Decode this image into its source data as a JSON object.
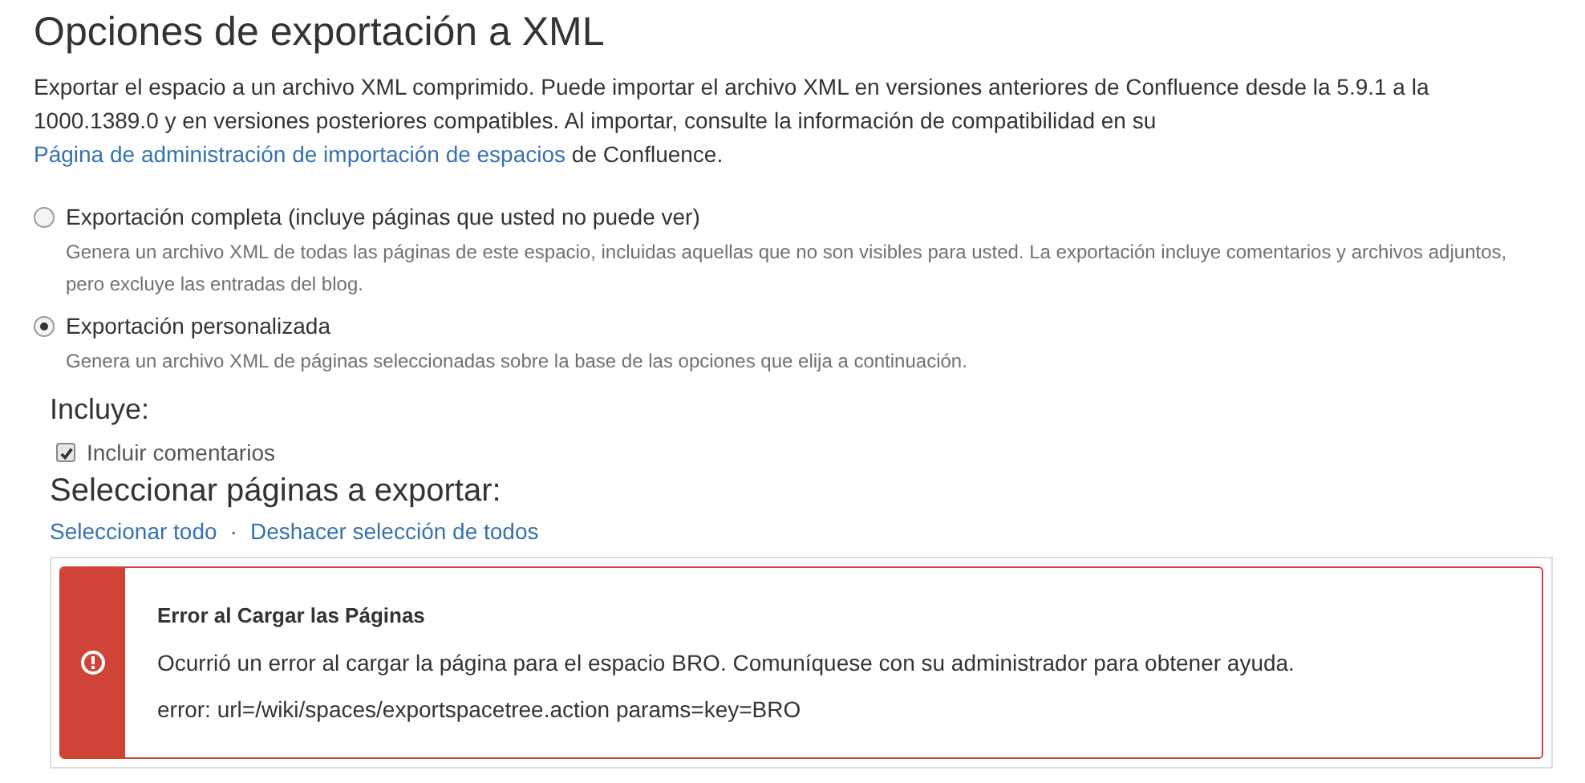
{
  "title": "Opciones de exportación a XML",
  "intro": {
    "before": "Exportar el espacio a un archivo XML comprimido. Puede importar el archivo XML en versiones anteriores de Confluence desde la 5.9.1 a la 1000.1389.0 y en versiones posteriores compatibles. Al importar, consulte la información de compatibilidad en su",
    "link": "Página de administración de importación de espacios",
    "after": "de Confluence."
  },
  "options": [
    {
      "label": "Exportación completa (incluye páginas que usted no puede ver)",
      "description": "Genera un archivo XML de todas las páginas de este espacio, incluidas aquellas que no son visibles para usted. La exportación incluye comentarios y archivos adjuntos, pero excluye las entradas del blog.",
      "selected": false
    },
    {
      "label": "Exportación personalizada",
      "description": "Genera un archivo XML de páginas seleccionadas sobre la base de las opciones que elija a continuación.",
      "selected": true
    }
  ],
  "includes": {
    "heading": "Incluye:",
    "checkbox": {
      "label": "Incluir comentarios",
      "checked": true
    }
  },
  "pages": {
    "heading": "Seleccionar páginas a exportar:",
    "links": [
      "Seleccionar todo",
      "Deshacer selección de todos"
    ],
    "separator": "·"
  },
  "error": {
    "title": "Error al Cargar las Páginas",
    "message": "Ocurrió un error al cargar la página para el espacio BRO. Comuníquese con su administrador para obtener ayuda.",
    "detail": "error: url=/wiki/spaces/exportspacetree.action params=key=BRO"
  }
}
